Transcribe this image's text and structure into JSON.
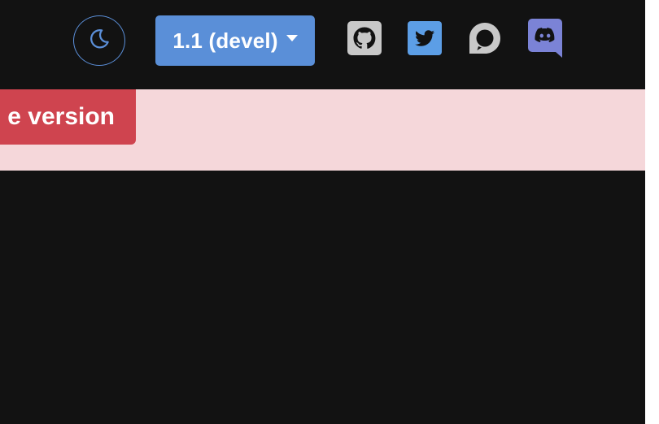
{
  "navbar": {
    "theme_toggle": {
      "icon": "moon-icon",
      "color": "#5b8fd9"
    },
    "version_button": {
      "label": "1.1 (devel)",
      "color": "#5a8fd8"
    },
    "social_links": [
      {
        "name": "github",
        "icon": "github-icon"
      },
      {
        "name": "twitter",
        "icon": "twitter-icon"
      },
      {
        "name": "discourse",
        "icon": "discourse-icon"
      },
      {
        "name": "discord",
        "icon": "discord-icon"
      }
    ]
  },
  "banner": {
    "button_label": "e version",
    "background": "#f5d7da",
    "button_color": "#cf444f"
  },
  "colors": {
    "page_background": "#121212"
  }
}
